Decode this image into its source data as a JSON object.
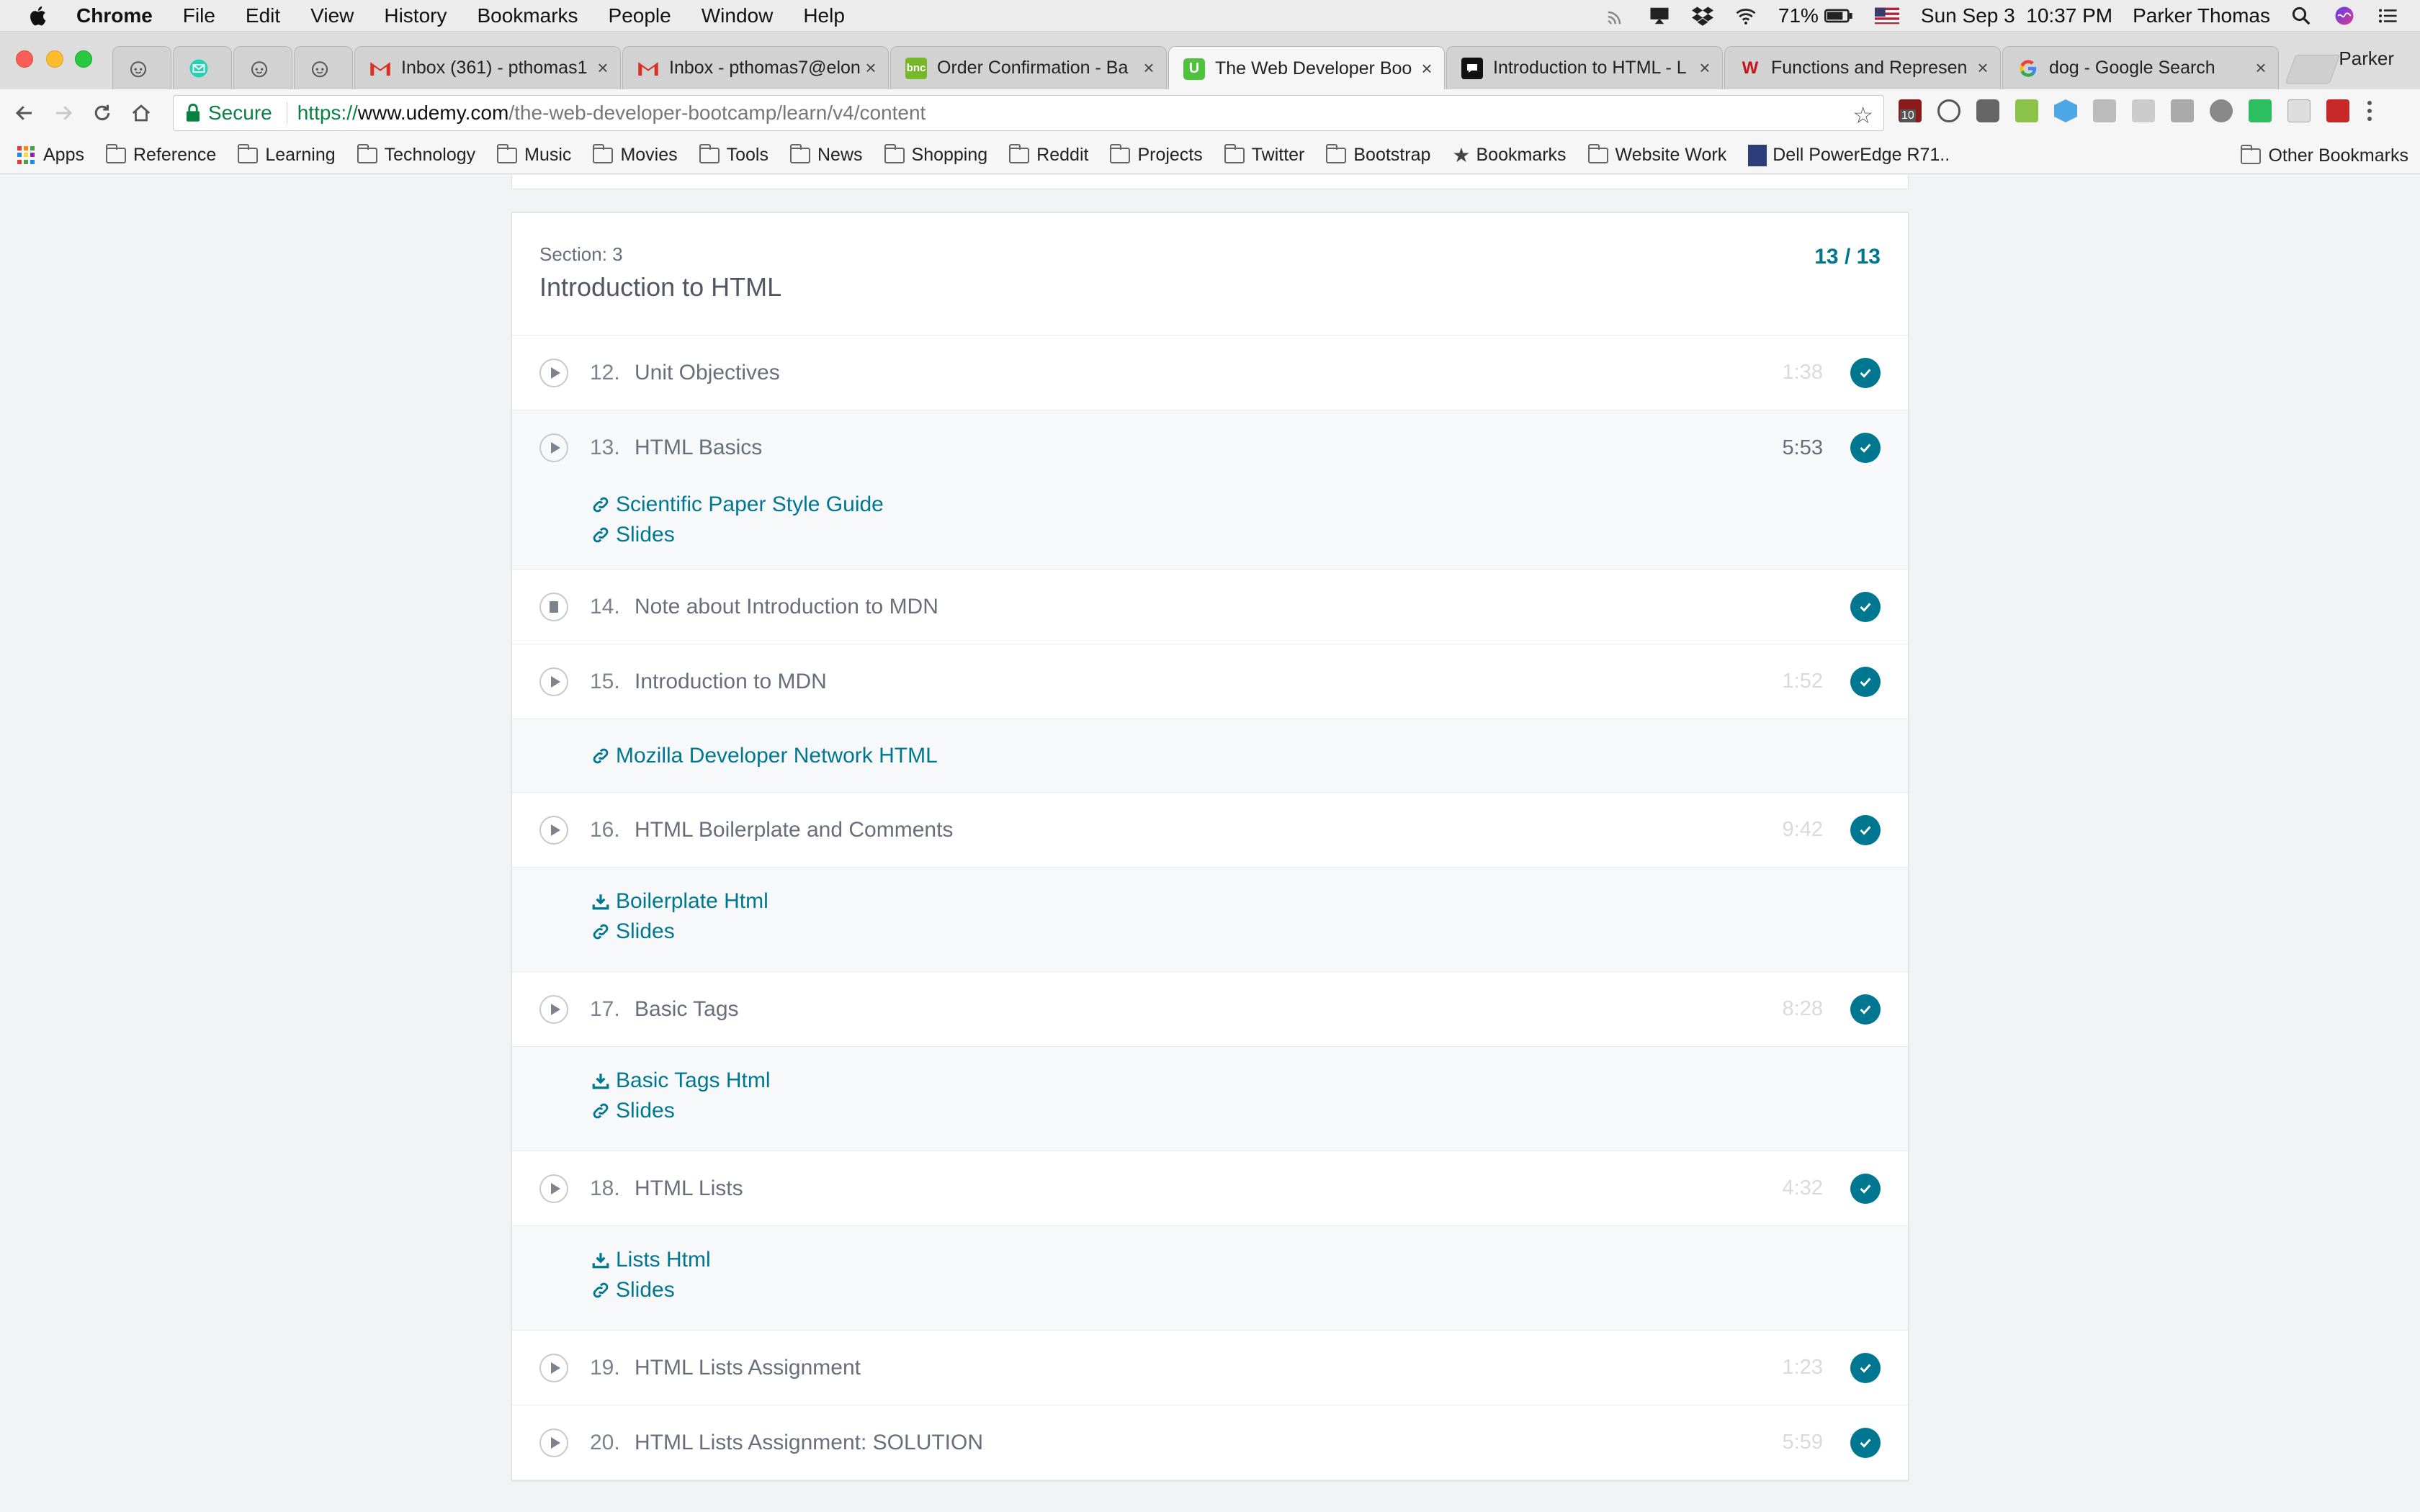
{
  "menubar": {
    "app": "Chrome",
    "items": [
      "File",
      "Edit",
      "View",
      "History",
      "Bookmarks",
      "People",
      "Window",
      "Help"
    ],
    "battery": "71%",
    "datetime": "Sun Sep 3  10:37 PM",
    "user": "Parker Thomas"
  },
  "tabs": [
    {
      "title": "",
      "favicon": "reddit-icon"
    },
    {
      "title": "",
      "favicon": "mail-icon"
    },
    {
      "title": "",
      "favicon": "reddit-icon"
    },
    {
      "title": "",
      "favicon": "reddit-icon"
    },
    {
      "title": "Inbox (361) - pthomas1",
      "favicon": "gmail-icon"
    },
    {
      "title": "Inbox - pthomas7@elon",
      "favicon": "gmail-icon"
    },
    {
      "title": "Order Confirmation - Ba",
      "favicon": "bnc-icon"
    },
    {
      "title": "The Web Developer Boo",
      "favicon": "udemy-icon",
      "active": true
    },
    {
      "title": "Introduction to HTML - L",
      "favicon": "page-icon"
    },
    {
      "title": "Functions and Represen",
      "favicon": "wolfram-icon"
    },
    {
      "title": "dog - Google Search",
      "favicon": "google-icon"
    }
  ],
  "profile_name": "Parker",
  "toolbar": {
    "secure_label": "Secure",
    "url_scheme": "https://",
    "url_host": "www.udemy.com",
    "url_path": "/the-web-developer-bootcamp/learn/v4/content"
  },
  "bookmarks": {
    "apps": "Apps",
    "items": [
      "Reference",
      "Learning",
      "Technology",
      "Music",
      "Movies",
      "Tools",
      "News",
      "Shopping",
      "Reddit",
      "Projects",
      "Twitter",
      "Bootstrap"
    ],
    "starred": "Bookmarks",
    "website_work": "Website Work",
    "dell": "Dell PowerEdge R71..",
    "other": "Other Bookmarks"
  },
  "section": {
    "label": "Section: 3",
    "title": "Introduction to HTML",
    "progress": "13 / 13"
  },
  "lectures": [
    {
      "num": "12.",
      "title": "Unit Objectives",
      "duration": "1:38",
      "type": "video",
      "resources": []
    },
    {
      "num": "13.",
      "title": "HTML Basics",
      "duration": "5:53",
      "type": "video",
      "expanded": true,
      "resources": [
        {
          "kind": "link",
          "label": "Scientific Paper Style Guide"
        },
        {
          "kind": "link",
          "label": "Slides"
        }
      ]
    },
    {
      "num": "14.",
      "title": "Note about Introduction to MDN",
      "duration": "",
      "type": "article",
      "resources": []
    },
    {
      "num": "15.",
      "title": "Introduction to MDN",
      "duration": "1:52",
      "type": "video",
      "resources": [
        {
          "kind": "link",
          "label": "Mozilla Developer Network HTML"
        }
      ]
    },
    {
      "num": "16.",
      "title": "HTML Boilerplate and Comments",
      "duration": "9:42",
      "type": "video",
      "resources": [
        {
          "kind": "download",
          "label": "Boilerplate Html"
        },
        {
          "kind": "link",
          "label": "Slides"
        }
      ]
    },
    {
      "num": "17.",
      "title": "Basic Tags",
      "duration": "8:28",
      "type": "video",
      "resources": [
        {
          "kind": "download",
          "label": "Basic Tags Html"
        },
        {
          "kind": "link",
          "label": "Slides"
        }
      ]
    },
    {
      "num": "18.",
      "title": "HTML Lists",
      "duration": "4:32",
      "type": "video",
      "resources": [
        {
          "kind": "download",
          "label": "Lists Html"
        },
        {
          "kind": "link",
          "label": "Slides"
        }
      ]
    },
    {
      "num": "19.",
      "title": "HTML Lists Assignment",
      "duration": "1:23",
      "type": "video",
      "resources": []
    },
    {
      "num": "20.",
      "title": "HTML Lists Assignment: SOLUTION",
      "duration": "5:59",
      "type": "video",
      "resources": []
    }
  ],
  "colors": {
    "accent": "#007791",
    "muted_text": "#686f7a",
    "faint_duration": "#d9dadc"
  }
}
